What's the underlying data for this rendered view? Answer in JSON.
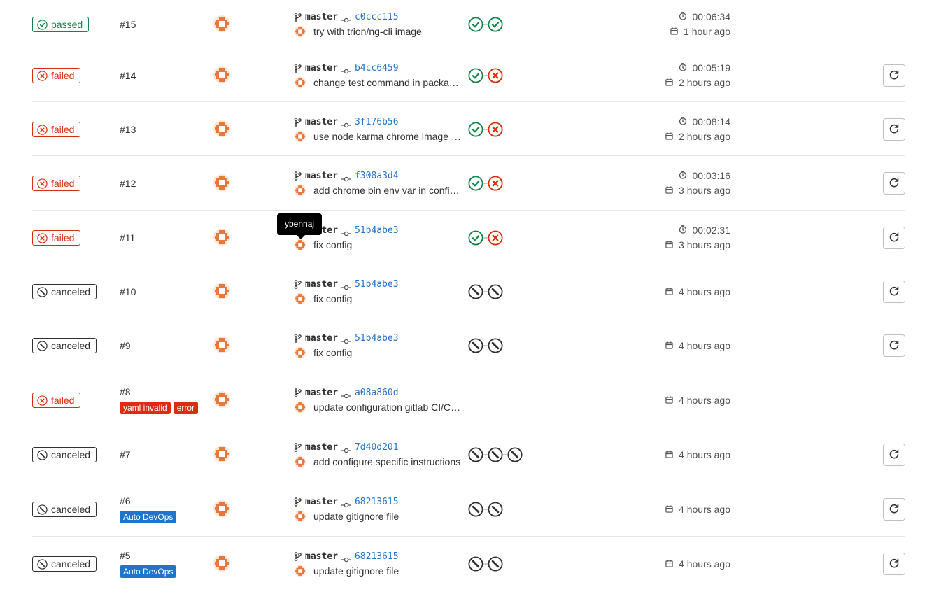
{
  "colors": {
    "passed": "#108548",
    "failed": "#dd2b0e",
    "canceled": "#303030",
    "link": "#1f75cb",
    "avatar": "#e8773a"
  },
  "tooltip": {
    "text": "ybennaj"
  },
  "pipelines": [
    {
      "status": "passed",
      "status_label": "passed",
      "id": "#15",
      "labels": [],
      "branch": "master",
      "sha": "c0ccc115",
      "message": "try with trion/ng-cli image",
      "stages": [
        "passed",
        "passed"
      ],
      "duration": "00:06:34",
      "finished": "1 hour ago",
      "retry": false
    },
    {
      "status": "failed",
      "status_label": "failed",
      "id": "#14",
      "labels": [],
      "branch": "master",
      "sha": "b4cc6459",
      "message": "change test command in package.json",
      "stages": [
        "passed",
        "failed"
      ],
      "duration": "00:05:19",
      "finished": "2 hours ago",
      "retry": true
    },
    {
      "status": "failed",
      "status_label": "failed",
      "id": "#13",
      "labels": [],
      "branch": "master",
      "sha": "3f176b56",
      "message": "use node karma chrome image in config",
      "stages": [
        "passed",
        "failed"
      ],
      "duration": "00:08:14",
      "finished": "2 hours ago",
      "retry": true
    },
    {
      "status": "failed",
      "status_label": "failed",
      "id": "#12",
      "labels": [],
      "branch": "master",
      "sha": "f308a3d4",
      "message": "add chrome bin env var in config file",
      "stages": [
        "passed",
        "failed"
      ],
      "duration": "00:03:16",
      "finished": "3 hours ago",
      "retry": true
    },
    {
      "status": "failed",
      "status_label": "failed",
      "id": "#11",
      "labels": [],
      "branch": "master",
      "sha": "51b4abe3",
      "message": "fix config",
      "stages": [
        "passed",
        "failed"
      ],
      "duration": "00:02:31",
      "finished": "3 hours ago",
      "retry": true
    },
    {
      "status": "canceled",
      "status_label": "canceled",
      "id": "#10",
      "labels": [],
      "branch": "master",
      "sha": "51b4abe3",
      "message": "fix config",
      "stages": [
        "canceled",
        "canceled"
      ],
      "duration": "",
      "finished": "4 hours ago",
      "retry": true
    },
    {
      "status": "canceled",
      "status_label": "canceled",
      "id": "#9",
      "labels": [],
      "branch": "master",
      "sha": "51b4abe3",
      "message": "fix config",
      "stages": [
        "canceled",
        "canceled"
      ],
      "duration": "",
      "finished": "4 hours ago",
      "retry": true
    },
    {
      "status": "failed",
      "status_label": "failed",
      "id": "#8",
      "labels": [
        {
          "text": "yaml invalid",
          "color": "red"
        },
        {
          "text": "error",
          "color": "red"
        }
      ],
      "branch": "master",
      "sha": "a08a860d",
      "message": "update configuration gitlab CI/CD file",
      "stages": [],
      "duration": "",
      "finished": "4 hours ago",
      "retry": false
    },
    {
      "status": "canceled",
      "status_label": "canceled",
      "id": "#7",
      "labels": [],
      "branch": "master",
      "sha": "7d40d201",
      "message": "add configure specific instructions",
      "stages": [
        "canceled",
        "canceled",
        "canceled"
      ],
      "duration": "",
      "finished": "4 hours ago",
      "retry": true
    },
    {
      "status": "canceled",
      "status_label": "canceled",
      "id": "#6",
      "labels": [
        {
          "text": "Auto DevOps",
          "color": "blue"
        }
      ],
      "branch": "master",
      "sha": "68213615",
      "message": "update gitignore file",
      "stages": [
        "canceled",
        "canceled"
      ],
      "duration": "",
      "finished": "4 hours ago",
      "retry": true
    },
    {
      "status": "canceled",
      "status_label": "canceled",
      "id": "#5",
      "labels": [
        {
          "text": "Auto DevOps",
          "color": "blue"
        }
      ],
      "branch": "master",
      "sha": "68213615",
      "message": "update gitignore file",
      "stages": [
        "canceled",
        "canceled"
      ],
      "duration": "",
      "finished": "4 hours ago",
      "retry": true
    }
  ]
}
